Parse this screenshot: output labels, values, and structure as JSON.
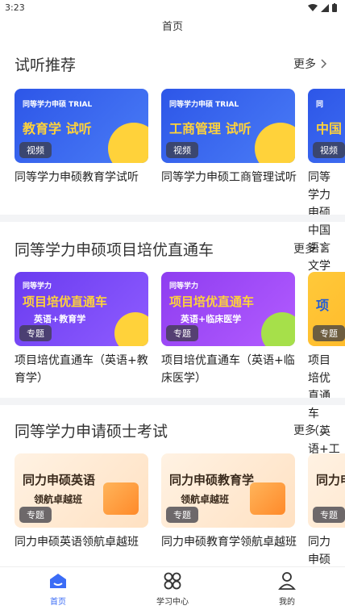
{
  "status": {
    "time": "3:23"
  },
  "header": {
    "title": "首页"
  },
  "sections": [
    {
      "title": "试听推荐",
      "more": "更多",
      "cards": [
        {
          "title": "同等学力申硕教育学试听",
          "badge": "视频",
          "banner_top": "同等学力申硕 TRIAL",
          "banner_main": "教育学 试听"
        },
        {
          "title": "同等学力申硕工商管理试听",
          "badge": "视频",
          "banner_top": "同等学力申硕 TRIAL",
          "banner_main": "工商管理 试听"
        },
        {
          "title": "同等学力申硕中国语言文学试听",
          "badge": "视频",
          "banner_top": "同",
          "banner_main": "中国"
        }
      ]
    },
    {
      "title": "同等学力申硕项目培优直通车",
      "more": "更多",
      "cards": [
        {
          "title": "项目培优直通车（英语+教育学）",
          "badge": "专题",
          "banner_top": "同等学力",
          "banner_main": "项目培优直通车",
          "banner_sub": "英语+教育学"
        },
        {
          "title": "项目培优直通车（英语+临床医学）",
          "badge": "专题",
          "banner_top": "同等学力",
          "banner_main": "项目培优直通车",
          "banner_sub": "英语+临床医学"
        },
        {
          "title": "项目培优直通车（英语+工商管理）",
          "badge": "专题",
          "banner_top": "",
          "banner_main": "项",
          "banner_sub": ""
        }
      ]
    },
    {
      "title": "同等学力申请硕士考试",
      "more": "更多",
      "cards": [
        {
          "title": "同力申硕英语领航卓越班",
          "badge": "专题",
          "banner_main": "同力申硕英语",
          "banner_sub": "领航卓越班"
        },
        {
          "title": "同力申硕教育学领航卓越班",
          "badge": "专题",
          "banner_main": "同力申硕教育学",
          "banner_sub": "领航卓越班"
        },
        {
          "title": "同力申硕领航卓越班",
          "badge": "专题",
          "banner_main": "同力申",
          "banner_sub": "领航"
        }
      ]
    }
  ],
  "tabbar": {
    "items": [
      {
        "label": "首页",
        "icon": "home-icon",
        "active": true
      },
      {
        "label": "学习中心",
        "icon": "grid-icon",
        "active": false
      },
      {
        "label": "我的",
        "icon": "user-icon",
        "active": false
      }
    ]
  },
  "colors": {
    "accent": "#3b6cf6",
    "section_gap": "#f3f4f6"
  }
}
